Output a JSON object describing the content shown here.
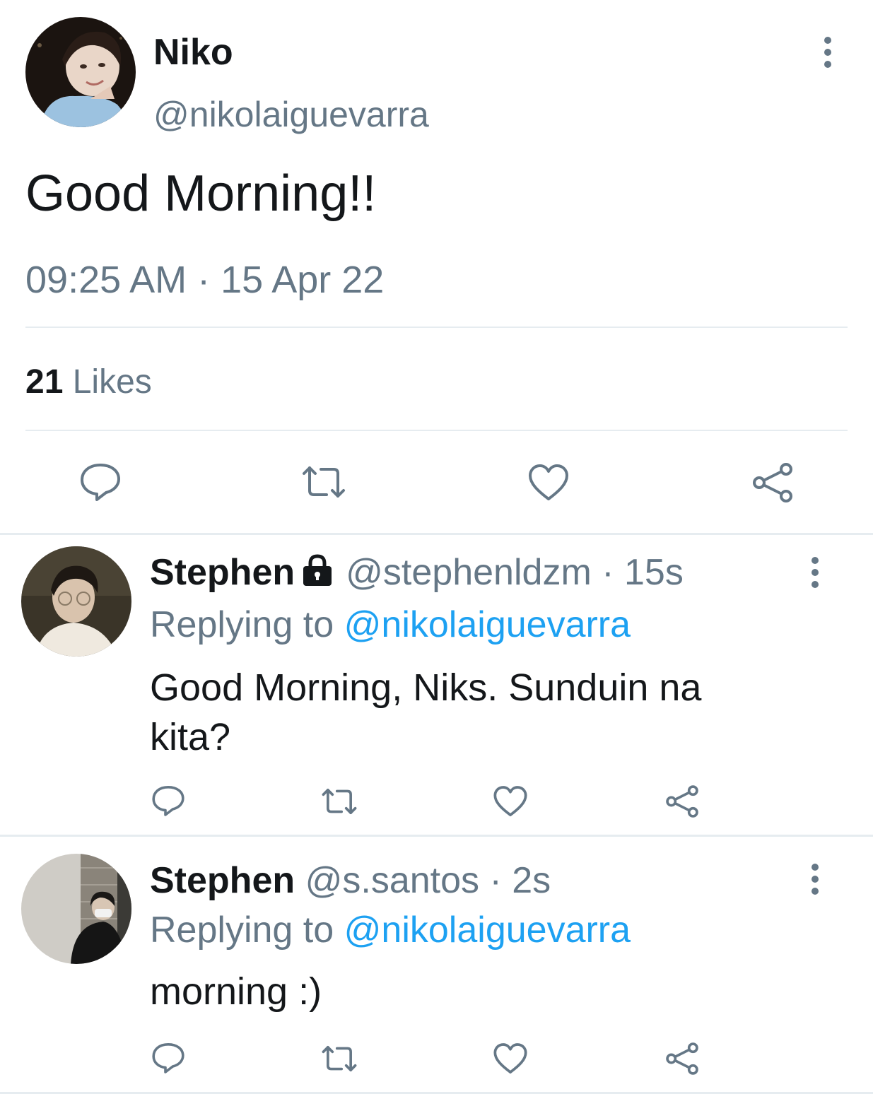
{
  "main_tweet": {
    "name": "Niko",
    "handle": "@nikolaiguevarra",
    "text": "Good Morning!!",
    "timestamp": "09:25 AM · 15 Apr 22",
    "likes_count": "21",
    "likes_label": "Likes",
    "icons": [
      "more-vertical-icon",
      "reply-icon",
      "retweet-icon",
      "like-icon",
      "share-icon"
    ]
  },
  "replies": [
    {
      "name": "Stephen",
      "protected": true,
      "handle": "@stephenldzm",
      "time": "· 15s",
      "replying_label": "Replying to",
      "replying_handle": "@nikolaiguevarra",
      "text": "Good Morning, Niks. Sunduin na kita?"
    },
    {
      "name": "Stephen",
      "protected": false,
      "handle": "@s.santos",
      "time": "· 2s",
      "replying_label": "Replying to",
      "replying_handle": "@nikolaiguevarra",
      "text": "morning :)"
    }
  ],
  "colors": {
    "text": "#14171a",
    "secondary": "#657786",
    "link": "#1da1f2",
    "divider": "#e6ecf0"
  }
}
